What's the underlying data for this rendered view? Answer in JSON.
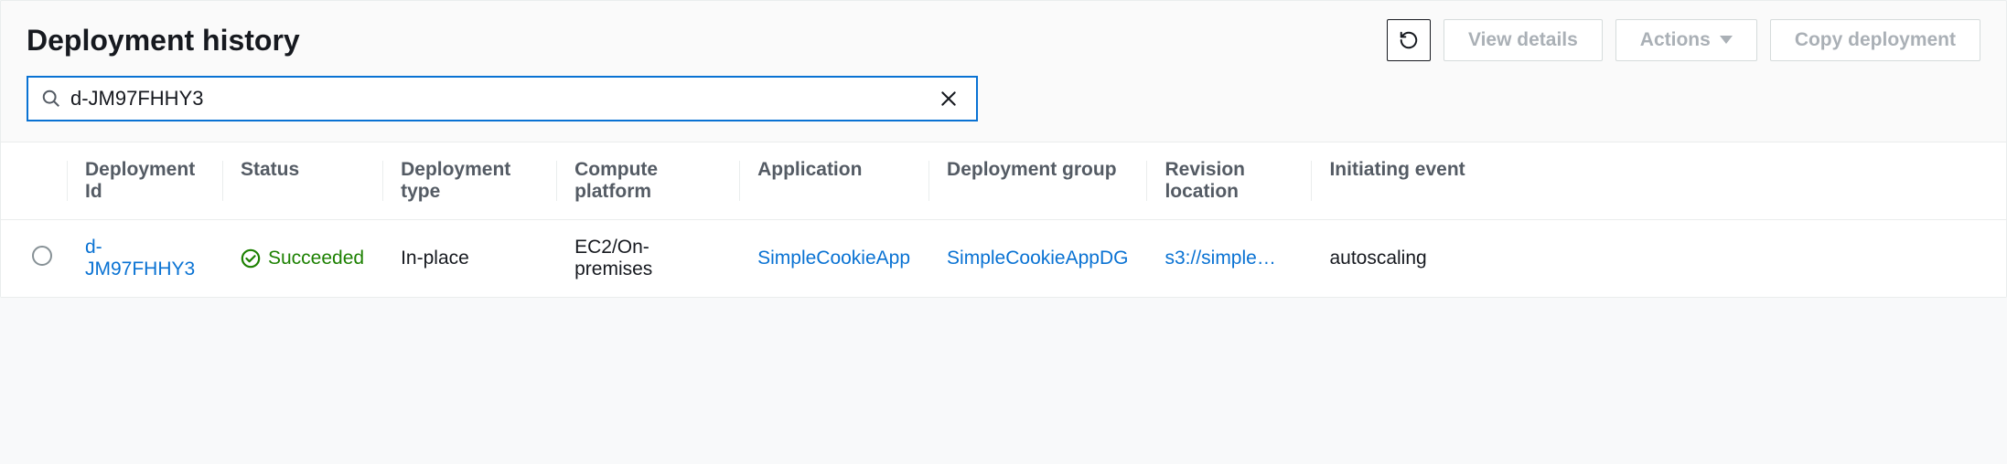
{
  "header": {
    "title": "Deployment history",
    "buttons": {
      "view_details": "View details",
      "actions": "Actions",
      "copy_deployment": "Copy deployment"
    }
  },
  "search": {
    "value": "d-JM97FHHY3"
  },
  "table": {
    "columns": {
      "deployment_id": "Deployment Id",
      "status": "Status",
      "deployment_type": "Deployment type",
      "compute_platform": "Compute platform",
      "application": "Application",
      "deployment_group": "Deployment group",
      "revision_location": "Revision location",
      "initiating_event": "Initiating event"
    },
    "rows": [
      {
        "deployment_id": "d-JM97FHHY3",
        "status": "Succeeded",
        "deployment_type": "In-place",
        "compute_platform": "EC2/On-premises",
        "application": "SimpleCookieApp",
        "deployment_group": "SimpleCookieAppDG",
        "revision_location": "s3://simple…",
        "initiating_event": "autoscaling"
      }
    ]
  },
  "colors": {
    "link": "#0972d3",
    "success": "#1d8102"
  }
}
